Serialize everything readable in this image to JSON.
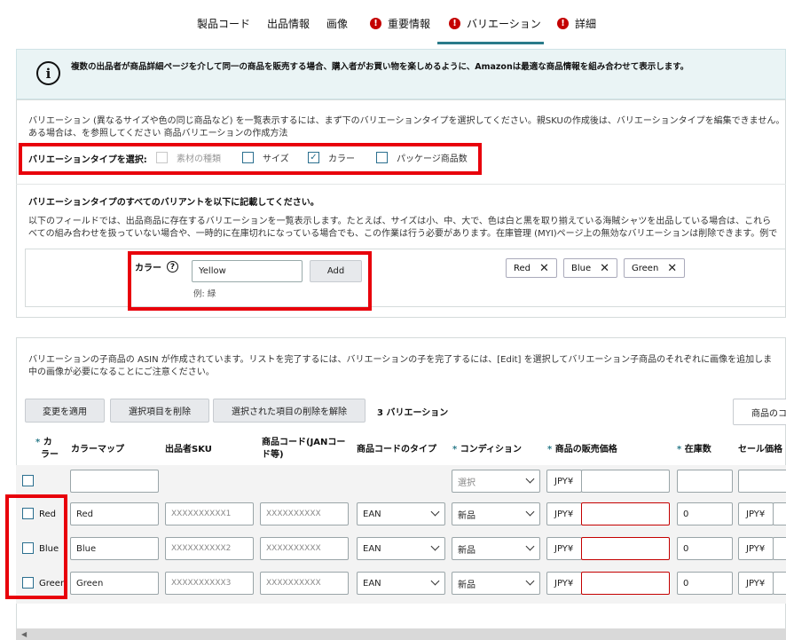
{
  "tabs": [
    {
      "label": "製品コード",
      "error": false
    },
    {
      "label": "出品情報",
      "error": false
    },
    {
      "label": "画像",
      "error": false
    },
    {
      "label": "重要情報",
      "error": true
    },
    {
      "label": "バリエーション",
      "error": true,
      "active": true
    },
    {
      "label": "詳細",
      "error": true
    }
  ],
  "info_banner": {
    "text": "複数の出品者が商品詳細ページを介して同一の商品を販売する場合、購入者がお買い物を楽しめるように、Amazonは最適な商品情報を組み合わせて表示します。",
    "icon": "info-icon"
  },
  "variation_section": {
    "intro_line1": "バリエーション (異なるサイズや色の同じ商品など) を一覧表示するには、まず下のバリエーションタイプを選択してください。親SKUの作成後は、バリエーションタイプを編集できません。",
    "intro_line2": "ある場合は、を参照してください 商品バリエーションの作成方法",
    "select_label": "バリエーションタイプを選択:",
    "options": [
      {
        "label": "素材の種類",
        "checked": false,
        "disabled": true
      },
      {
        "label": "サイズ",
        "checked": false,
        "disabled": false
      },
      {
        "label": "カラー",
        "checked": true,
        "disabled": false
      },
      {
        "label": "パッケージ商品数",
        "checked": false,
        "disabled": false
      }
    ]
  },
  "variants_section": {
    "heading": "バリエーションタイプのすべてのバリアントを以下に記載してください。",
    "desc_line1": "以下のフィールドでは、出品商品に存在するバリエーションを一覧表示します。たとえば、サイズは小、中、大で、色は白と黒を取り揃えている海賊シャツを出品している場合は、これら",
    "desc_line2": "べての組み合わせを扱っていない場合や、一時的に在庫切れになっている場合でも、この作業は行う必要があります。在庫管理 (MYI)ページ上の無効なバリエーションは削除できます。例で",
    "color_label": "カラー",
    "help_icon": "help-icon",
    "color_input_value": "Yellow",
    "add_label": "Add",
    "example": "例: 緑",
    "chips": [
      "Red",
      "Blue",
      "Green"
    ]
  },
  "children_section": {
    "desc_line1": "バリエーションの子商品の ASIN が作成されています。リストを完了するには、バリエーションの子を完了するには、[Edit] を選択してバリエーション子商品のそれぞれに画像を追加しま",
    "desc_line2": "中の画像が必要になることにご注意ください。",
    "buttons": [
      "変更を適用",
      "選択項目を削除",
      "選択された項目の削除を解除"
    ],
    "count_label": "3 バリエーション",
    "right_button": "商品のコ"
  },
  "table": {
    "headers": {
      "color_req": "*",
      "color": "カ",
      "color2": "ラー",
      "color_map": "カラーマップ",
      "sku": "出品者SKU",
      "product_code": "商品コード(JANコー",
      "product_code2": "ド等)",
      "code_type": "商品コードのタイプ",
      "condition": "コンディション",
      "price": "商品の販売価格",
      "stock": "在庫数",
      "sale_price": "セール価格"
    },
    "filter_row": {
      "condition": "選択",
      "currency": "JPY¥"
    },
    "rows": [
      {
        "color": "Red",
        "color_map": "Red",
        "sku": "XXXXXXXXXX1",
        "product_code": "XXXXXXXXXX",
        "code_type": "EAN",
        "condition": "新品",
        "currency": "JPY¥",
        "price": "",
        "stock": "0",
        "sale_currency": "JPY¥"
      },
      {
        "color": "Blue",
        "color_map": "Blue",
        "sku": "XXXXXXXXXX2",
        "product_code": "XXXXXXXXXX",
        "code_type": "EAN",
        "condition": "新品",
        "currency": "JPY¥",
        "price": "",
        "stock": "0",
        "sale_currency": "JPY¥"
      },
      {
        "color": "Green",
        "color_map": "Green",
        "sku": "XXXXXXXXXX3",
        "product_code": "XXXXXXXXXX",
        "code_type": "EAN",
        "condition": "新品",
        "currency": "JPY¥",
        "price": "",
        "stock": "0",
        "sale_currency": "JPY¥"
      }
    ]
  },
  "colors": {
    "accent": "#2a7b8a",
    "error": "#c40000",
    "highlight_box": "#e8000b",
    "banner_bg": "#eaf4f5"
  }
}
